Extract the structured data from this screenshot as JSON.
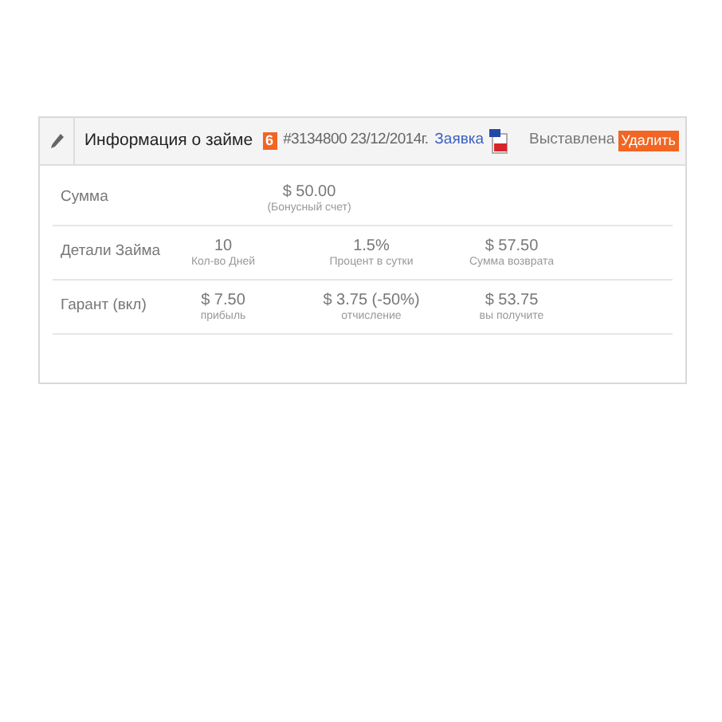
{
  "header": {
    "title": "Информация о займе",
    "badge": "6",
    "reference": "#3134800 23/12/2014г.",
    "link": "Заявка",
    "status": "Выставлена",
    "delete_button": "Удалить"
  },
  "rows": [
    {
      "kind": "single",
      "label": "Сумма",
      "cells": [
        {
          "value": "$ 50.00",
          "caption": "(Бонусный счет)"
        }
      ]
    },
    {
      "kind": "multi",
      "label": "Детали Займа",
      "cells": [
        {
          "value": "10",
          "caption": "Кол-во Дней"
        },
        {
          "value": "1.5%",
          "caption": "Процент в сутки"
        },
        {
          "value": "$ 57.50",
          "caption": "Сумма возврата"
        }
      ]
    },
    {
      "kind": "multi",
      "label": "Гарант (вкл)",
      "cells": [
        {
          "value": "$ 7.50",
          "caption": "прибыль"
        },
        {
          "value": "$ 3.75 (-50%)",
          "caption": "отчисление"
        },
        {
          "value": "$ 53.75",
          "caption": "вы получите"
        }
      ]
    }
  ]
}
